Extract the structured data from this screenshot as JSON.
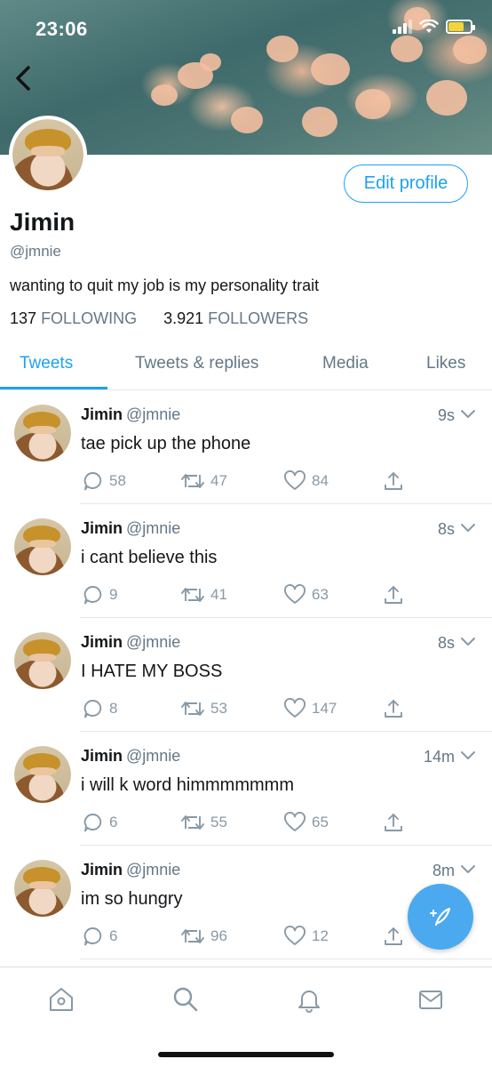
{
  "status_bar": {
    "time": "23:06"
  },
  "profile": {
    "name": "Jimin",
    "handle": "@jmnie",
    "bio": "wanting to quit my job is my personality trait",
    "edit_button": "Edit profile",
    "following_count": "137",
    "following_label": "FOLLOWING",
    "followers_count": "3.921",
    "followers_label": "FOLLOWERS"
  },
  "tabs": [
    {
      "label": "Tweets"
    },
    {
      "label": "Tweets & replies"
    },
    {
      "label": "Media"
    },
    {
      "label": "Likes"
    }
  ],
  "tweets": [
    {
      "name": "Jimin",
      "handle": "@jmnie",
      "time": "9s",
      "text": "tae pick up the phone",
      "replies": "58",
      "retweets": "47",
      "likes": "84"
    },
    {
      "name": "Jimin",
      "handle": "@jmnie",
      "time": "8s",
      "text": "i cant believe this",
      "replies": "9",
      "retweets": "41",
      "likes": "63"
    },
    {
      "name": "Jimin",
      "handle": "@jmnie",
      "time": "8s",
      "text": "I HATE MY BOSS",
      "replies": "8",
      "retweets": "53",
      "likes": "147"
    },
    {
      "name": "Jimin",
      "handle": "@jmnie",
      "time": "14m",
      "text": "i will k word himmmmmmm",
      "replies": "6",
      "retweets": "55",
      "likes": "65"
    },
    {
      "name": "Jimin",
      "handle": "@jmnie",
      "time": "8m",
      "text": "im so hungry",
      "replies": "6",
      "retweets": "96",
      "likes": "12"
    }
  ],
  "colors": {
    "accent": "#1da1f2",
    "muted": "#657786",
    "icon": "#8899a6"
  },
  "icons": {
    "back": "chevron-left-icon",
    "reply": "reply-icon",
    "retweet": "retweet-icon",
    "like": "heart-icon",
    "share": "share-icon",
    "compose": "compose-tweet-icon",
    "nav": [
      "home-icon",
      "search-icon",
      "notifications-icon",
      "messages-icon"
    ]
  }
}
